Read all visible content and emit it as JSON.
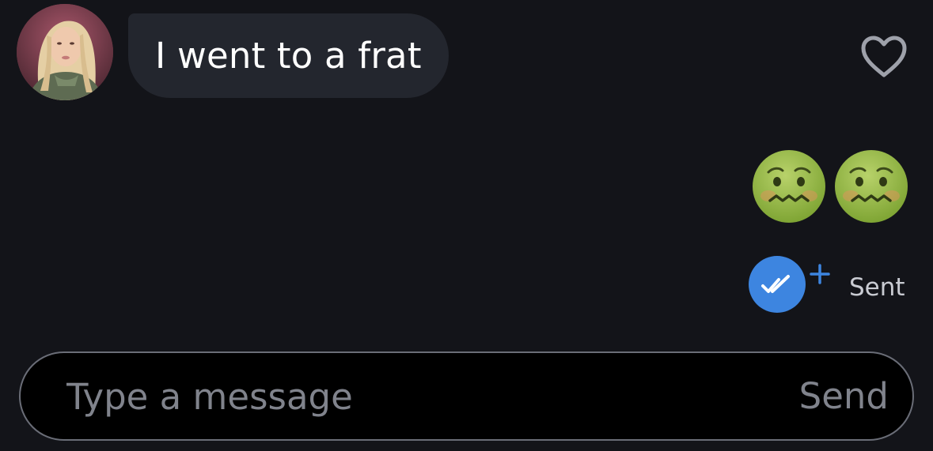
{
  "conversation": {
    "incoming_message": {
      "text": "I went to a frat",
      "avatar_icon": "profile-photo",
      "like_icon": "heart-outline-icon"
    },
    "outgoing_message": {
      "emojis": [
        "nauseated-face-emoji",
        "nauseated-face-emoji"
      ],
      "status_text": "Sent",
      "read_icon": "double-check-icon",
      "extra_icon": "plus-icon"
    }
  },
  "composer": {
    "placeholder": "Type a message",
    "value": "",
    "send_label": "Send"
  },
  "colors": {
    "background": "#131419",
    "incoming_bubble": "#23262e",
    "accent": "#3d85e0",
    "muted_text": "#80838c"
  }
}
